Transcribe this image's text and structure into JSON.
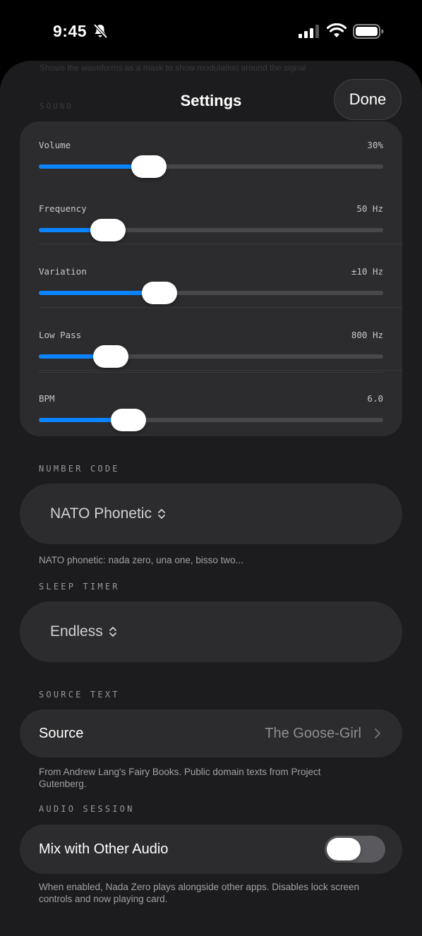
{
  "status_bar": {
    "time": "9:45"
  },
  "header": {
    "title": "Settings",
    "done_label": "Done"
  },
  "background_text": {
    "lines": "Shows the waveforms as a mask to show modulation around the signal",
    "label": "SOUND"
  },
  "sliders": [
    {
      "label": "Volume",
      "value": "30%",
      "fraction": 0.32
    },
    {
      "label": "Frequency",
      "value": "50 Hz",
      "fraction": 0.2
    },
    {
      "label": "Variation",
      "value": "±10 Hz",
      "fraction": 0.35
    },
    {
      "label": "Low Pass",
      "value": "800 Hz",
      "fraction": 0.21
    },
    {
      "label": "BPM",
      "value": "6.0",
      "fraction": 0.26
    }
  ],
  "number_code": {
    "section_label": "NUMBER CODE",
    "selected": "NATO Phonetic",
    "footnote": "NATO phonetic: nada zero, una one, bisso two..."
  },
  "sleep_timer": {
    "section_label": "SLEEP TIMER",
    "selected": "Endless"
  },
  "source_text": {
    "section_label": "SOURCE TEXT",
    "row_label": "Source",
    "row_value": "The Goose-Girl",
    "footnote": "From Andrew Lang's Fairy Books. Public domain texts from Project Gutenberg."
  },
  "audio_session": {
    "section_label": "AUDIO SESSION",
    "row_label": "Mix with Other Audio",
    "toggle_on": false,
    "footnote": "When enabled, Nada Zero plays alongside other apps. Disables lock screen controls and now playing card."
  },
  "colors": {
    "accent": "#0a84ff",
    "card": "#2c2c2e",
    "sheet": "#1c1c1e"
  },
  "icons": [
    "bell-slash-icon",
    "cellular-signal-icon",
    "wifi-icon",
    "battery-icon",
    "chevron-up-down-icon",
    "chevron-right-icon"
  ]
}
